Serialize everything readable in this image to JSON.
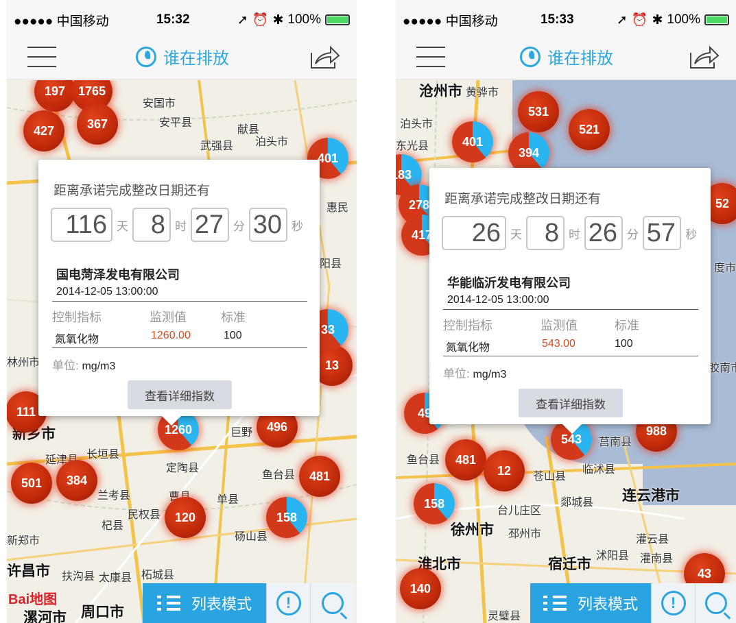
{
  "screens": [
    {
      "status": {
        "carrier": "●●●●● 中国移动",
        "time": "15:32",
        "battery": "100%"
      },
      "nav": {
        "title": "谁在排放"
      },
      "popup": {
        "heading": "距离承诺完成整改日期还有",
        "days": "116",
        "days_unit": "天",
        "hours": "8",
        "hours_unit": "时",
        "minutes": "27",
        "minutes_unit": "分",
        "seconds": "30",
        "seconds_unit": "秒",
        "company": "国电菏泽发电有限公司",
        "datetime": "2014-12-05 13:00:00",
        "headers": [
          "控制指标",
          "监测值",
          "标准"
        ],
        "row": {
          "indicator": "氮氧化物",
          "value": "1260.00",
          "standard": "100"
        },
        "unit_label": "单位:",
        "unit_value": "mg/m3",
        "detail_button": "查看详细指数"
      },
      "bottom": {
        "list_mode": "列表模式"
      },
      "map_logo": "Bai地图",
      "places": [
        "安国市",
        "安平县",
        "献县",
        "武强县",
        "泊头市",
        "惠民",
        "阳县",
        "林州市",
        "新乡市",
        "延津县",
        "长垣县",
        "定陶县",
        "鱼台县",
        "兰考县",
        "曹县",
        "单县",
        "民权县",
        "杞县",
        "砀山县",
        "新郑市",
        "许昌市",
        "扶沟县",
        "太康县",
        "柘城县",
        "周口市",
        "漯河市",
        "巨野"
      ],
      "markers": [
        "197",
        "1765",
        "427",
        "367",
        "401",
        "111",
        "1260",
        "496",
        "481",
        "501",
        "384",
        "120",
        "158",
        "13",
        "33"
      ]
    },
    {
      "status": {
        "carrier": "●●●●● 中国移动",
        "time": "15:33",
        "battery": "100%"
      },
      "nav": {
        "title": "谁在排放"
      },
      "popup": {
        "heading": "距离承诺完成整改日期还有",
        "days": "26",
        "days_unit": "天",
        "hours": "8",
        "hours_unit": "时",
        "minutes": "26",
        "minutes_unit": "分",
        "seconds": "57",
        "seconds_unit": "秒",
        "company": "华能临沂发电有限公司",
        "datetime": "2014-12-05 13:00:00",
        "headers": [
          "控制指标",
          "监测值",
          "标准"
        ],
        "row": {
          "indicator": "氮氧化物",
          "value": "543.00",
          "standard": "100"
        },
        "unit_label": "单位:",
        "unit_value": "mg/m3",
        "detail_button": "查看详细指数"
      },
      "bottom": {
        "list_mode": "列表模式"
      },
      "places": [
        "沧州市",
        "黄骅市",
        "泊头市",
        "东光县",
        "莒南县",
        "鱼台县",
        "苍山县",
        "临沭县",
        "连云港市",
        "台儿庄区",
        "郯城县",
        "徐州市",
        "邳州市",
        "灌云县",
        "淮北市",
        "宿迁市",
        "沭阳县",
        "灌南县",
        "灵璧县",
        "度市",
        "胶南市"
      ],
      "markers": [
        "531",
        "521",
        "401",
        "394",
        "183",
        "278",
        "52",
        "417",
        "543",
        "988",
        "481",
        "12",
        "158",
        "140",
        "43",
        "49"
      ]
    }
  ],
  "colors": {
    "accent": "#2aa4e0",
    "marker_red": "#c02a0a",
    "marker_blue": "#2bb5f0",
    "value_red": "#d84a1f"
  }
}
